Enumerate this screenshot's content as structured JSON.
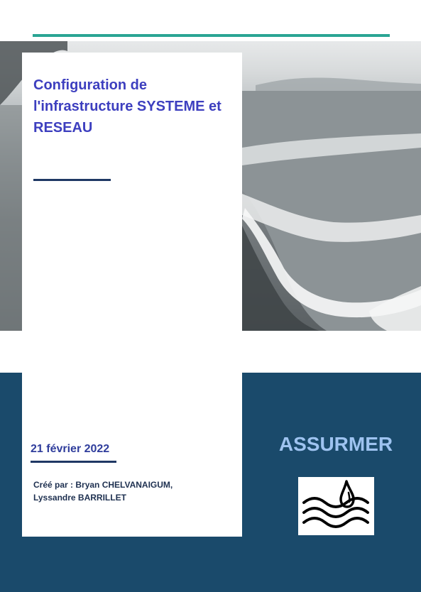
{
  "cover": {
    "title": "Configuration de l'infrastructure SYSTEME et RESEAU",
    "date": "21 février 2022",
    "author_line_1": "Créé par : Bryan CHELVANAIGUM,",
    "author_line_2": "Lyssandre BARRILLET",
    "company": "ASSURMER",
    "logo_icon": "water-drop-waves-icon"
  },
  "colors": {
    "accent_rule": "#2aa594",
    "title": "#3d3fbf",
    "band": "#1a4a6b",
    "company": "#9ec3f0"
  }
}
